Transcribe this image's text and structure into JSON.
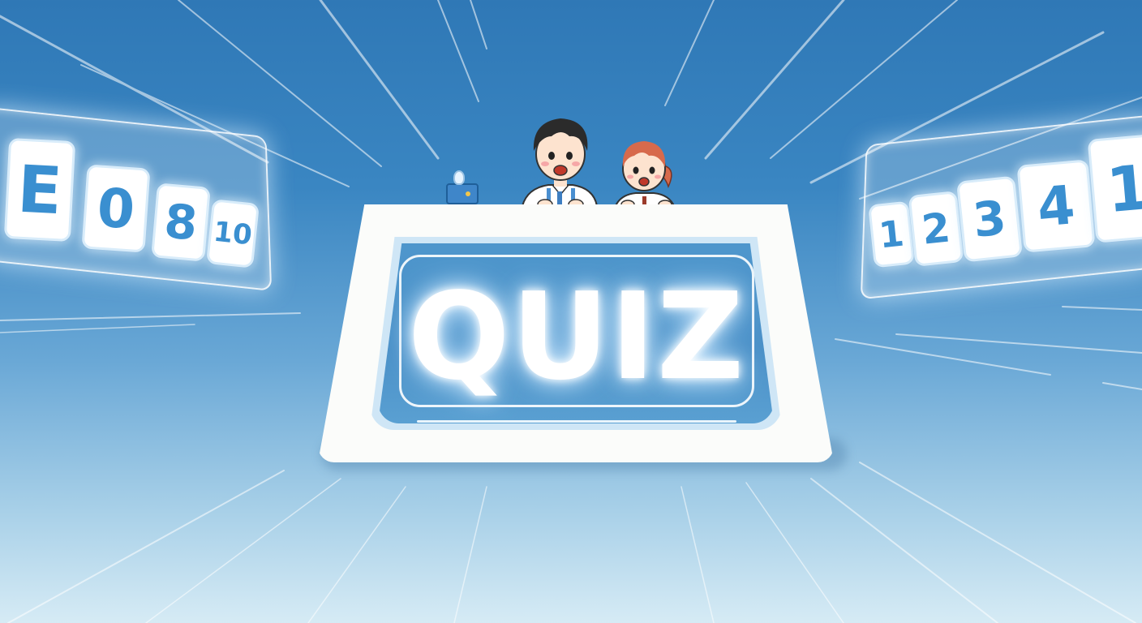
{
  "quiz_title": "QUIZ",
  "left_tiles": [
    "E",
    "0",
    "8",
    "10"
  ],
  "right_tiles": [
    "1",
    "2",
    "3",
    "4",
    "1"
  ],
  "colors": {
    "sky_top": "#2f78b6",
    "sky_bottom": "#d6ebf5",
    "tile_text": "#3a8fd0",
    "stand": "#fbfcfa",
    "screen": "#4a90c8"
  },
  "icons": {
    "buzzer": "buzzer-lamp-icon",
    "boy": "boy-contestant",
    "girl": "girl-contestant"
  }
}
